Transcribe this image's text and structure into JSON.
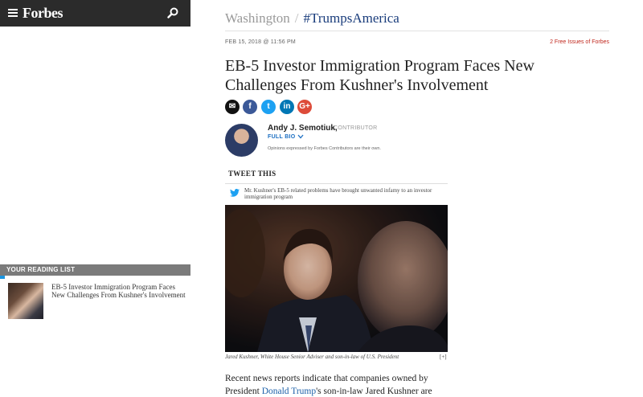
{
  "nav": {
    "logo": "Forbes"
  },
  "breadcrumb": {
    "section": "Washington",
    "separator": "/",
    "tag": "#TrumpsAmerica"
  },
  "article": {
    "date": "FEB 15, 2018 @ 11:56 PM",
    "promo": "2 Free Issues of Forbes",
    "headline_line1": "EB-5 Investor Immigration Program Faces New",
    "headline_line2": "Challenges From Kushner's Involvement",
    "author": {
      "name": "Andy J. Semotiuk,",
      "role": "CONTRIBUTOR",
      "full_bio": "FULL BIO",
      "disclaimer": "Opinions expressed by Forbes Contributors are their own."
    },
    "tweet": {
      "title": "TWEET THIS",
      "text": "Mr. Kushner's EB-5 related problems have brought unwanted infamy to an investor immigration program"
    },
    "photo_caption": "Jared Kushner, White House Senior Adviser and son-in-law of U.S. President",
    "expand_label": "[+]",
    "body_line1": "Recent news reports indicate that companies owned by",
    "body_prefix": "President ",
    "body_link": "Donald Trump",
    "body_suffix": "'s son-in-law Jared Kushner are"
  },
  "share_icons": [
    {
      "name": "email-icon",
      "glyph": "✉",
      "color": "#111111"
    },
    {
      "name": "facebook-icon",
      "glyph": "f",
      "color": "#3b5998"
    },
    {
      "name": "twitter-icon",
      "glyph": "t",
      "color": "#1da1f2"
    },
    {
      "name": "linkedin-icon",
      "glyph": "in",
      "color": "#0077b5"
    },
    {
      "name": "google-plus-icon",
      "glyph": "G+",
      "color": "#dd4b39"
    }
  ],
  "reading_list": {
    "header": "YOUR READING LIST",
    "items": [
      {
        "title": "EB-5 Investor Immigration Program Faces New Challenges From Kushner's Involvement"
      }
    ]
  }
}
